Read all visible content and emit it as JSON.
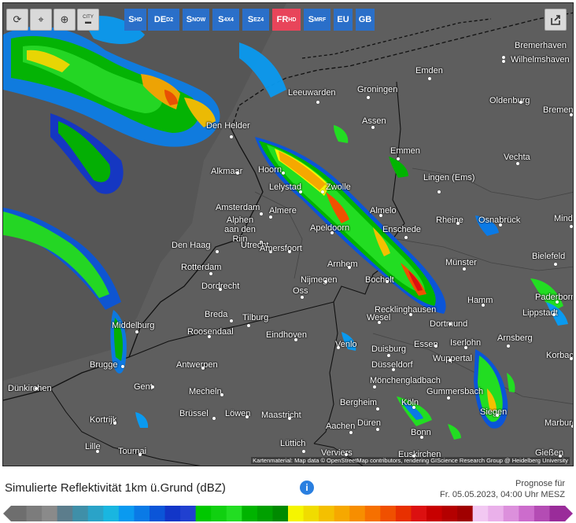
{
  "toolbar": {
    "refresh_icon": "refresh-icon",
    "location_icon": "location-pin-icon",
    "zoom_icon": "zoom-icon",
    "city_label": "CITY"
  },
  "models": [
    {
      "main": "S",
      "sub": "HD",
      "active": false
    },
    {
      "main": "DE",
      "sub": "D2",
      "active": false
    },
    {
      "main": "S",
      "sub": "NOW",
      "active": false
    },
    {
      "main": "S",
      "sub": "4X4",
      "active": false
    },
    {
      "main": "S",
      "sub": "EZ4",
      "active": false
    },
    {
      "main": "FR",
      "sub": "HD",
      "active": true
    },
    {
      "main": "S",
      "sub": "MRF",
      "active": false
    },
    {
      "main": "EU",
      "sub": "",
      "active": false
    },
    {
      "main": "GB",
      "sub": "",
      "active": false
    }
  ],
  "cities": [
    "Bremerhaven",
    "Wilhelmshaven",
    "Emden",
    "Oldenburg",
    "Bremen",
    "Leeuwarden",
    "Groningen",
    "Den Helder",
    "Assen",
    "Emmen",
    "Vechta",
    "Alkmaar",
    "Hoorn",
    "Lelystad",
    "Zwolle",
    "Lingen (Ems)",
    "Amsterdam",
    "Almere",
    "Almelo",
    "Rheine",
    "Osnabrück",
    "Minden",
    "Alphen aan den Rijn",
    "Apeldoorn",
    "Enschede",
    "Den Haag",
    "Utrecht",
    "Amersfoort",
    "Bielefeld",
    "Rotterdam",
    "Arnhem",
    "Münster",
    "Nijmegen",
    "Bocholt",
    "Dordrecht",
    "Oss",
    "Hamm",
    "Paderborn",
    "Lippstadt",
    "Recklinghausen",
    "Middelburg",
    "Breda",
    "Tilburg",
    "Wesel",
    "Dortmund",
    "Roosendaal",
    "Eindhoven",
    "Essen",
    "Iserlohn",
    "Arnsberg",
    "Venlo",
    "Duisburg",
    "Brugge",
    "Antwerpen",
    "Wuppertal",
    "Korbach",
    "Düsseldorf",
    "Mönchengladbach",
    "Gent",
    "Dünkirchen",
    "Mecheln",
    "Gummersbach",
    "Bergheim",
    "Köln",
    "Siegen",
    "Brüssel",
    "Löwen",
    "Maastricht",
    "Kortrijk",
    "Aachen",
    "Düren",
    "Marburg",
    "Bonn",
    "Lüttich",
    "Lille",
    "Tournai",
    "Verviers",
    "Euskirchen",
    "Gießen"
  ],
  "attribution": "Kartenmaterial: Map data © OpenStreetMap contributors, rendering GIScience Research Group @ Heidelberg University",
  "legend": {
    "title": "Simulierte Reflektivität 1km ü.Grund (dBZ)",
    "info_icon": "i",
    "forecast_label": "Prognose für",
    "forecast_time": "Fr. 05.05.2023, 04:00 Uhr MESZ"
  },
  "colors": {
    "map_background": "#5a5a5a",
    "button_blue": "#2a6fc9",
    "button_active": "#e8455a",
    "scale": [
      "#6e6e6e",
      "#7c7c7c",
      "#8a8a8a",
      "#5c7d8c",
      "#3f8fa8",
      "#2aa3c8",
      "#19b6e0",
      "#0a9af0",
      "#0a7ae6",
      "#0b55d8",
      "#1236c8",
      "#2040d0",
      "#00c800",
      "#10d010",
      "#22dd22",
      "#00b400",
      "#00a000",
      "#008a00",
      "#f5f500",
      "#f0dc00",
      "#f4c000",
      "#f6a800",
      "#f78e00",
      "#f67000",
      "#f05000",
      "#e83000",
      "#dc1010",
      "#c80000",
      "#b40000",
      "#a00000",
      "#f2c8f2",
      "#eab0ea",
      "#dc90dc",
      "#cc6ccc",
      "#b44cb4",
      "#9a2c9a"
    ]
  }
}
